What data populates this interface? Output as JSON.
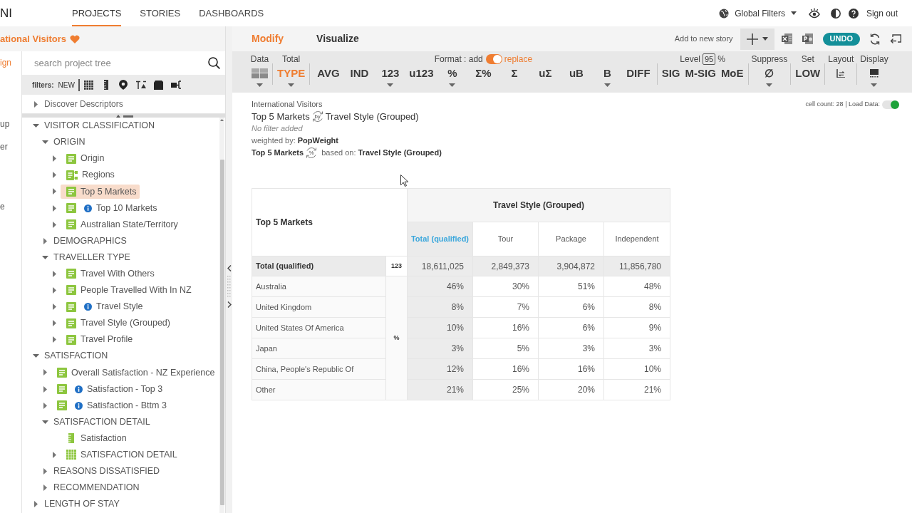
{
  "header": {
    "logo_text": "NI",
    "nav": [
      {
        "label": "PROJECTS",
        "selected": true
      },
      {
        "label": "STORIES",
        "selected": false
      },
      {
        "label": "DASHBOARDS",
        "selected": false
      }
    ],
    "global_filters": "Global Filters",
    "sign_out": "Sign out"
  },
  "project": {
    "title": "ational Visitors",
    "favorite": true
  },
  "left_menu": [
    {
      "label": "ign",
      "selected": true
    },
    {
      "label": "up",
      "selected": false
    },
    {
      "label": "er",
      "selected": false
    },
    {
      "label": "e",
      "selected": false
    }
  ],
  "sidebar": {
    "search": {
      "placeholder": "search project tree"
    },
    "filters_label": "filters:",
    "filters_new": "NEW",
    "descriptors": {
      "label": "Discover Descriptors",
      "expanded": false
    },
    "tree": [
      {
        "label": "VISITOR CLASSIFICATION",
        "kind": "folder",
        "expanded": true,
        "selected": false,
        "children": [
          {
            "label": "ORIGIN",
            "kind": "folder",
            "expanded": true,
            "selected": false,
            "children": [
              {
                "label": "Origin",
                "kind": "single",
                "expanded": false,
                "selected": false,
                "info": false
              },
              {
                "label": "Regions",
                "kind": "hierarchy",
                "expanded": false,
                "selected": false,
                "info": false
              },
              {
                "label": "Top 5 Markets",
                "kind": "single",
                "expanded": false,
                "selected": true,
                "info": false
              },
              {
                "label": "Top 10 Markets",
                "kind": "single",
                "expanded": false,
                "selected": false,
                "info": true
              },
              {
                "label": "Australian State/Territory",
                "kind": "single",
                "expanded": false,
                "selected": false,
                "info": false
              }
            ]
          },
          {
            "label": "DEMOGRAPHICS",
            "kind": "folder",
            "expanded": false,
            "selected": false
          },
          {
            "label": "TRAVELLER TYPE",
            "kind": "folder",
            "expanded": true,
            "selected": false,
            "children": [
              {
                "label": "Travel With Others",
                "kind": "single",
                "expanded": false,
                "selected": false,
                "info": false
              },
              {
                "label": "People Travelled With In NZ",
                "kind": "single",
                "expanded": false,
                "selected": false,
                "info": false
              },
              {
                "label": "Travel Style",
                "kind": "single",
                "expanded": false,
                "selected": false,
                "info": true
              },
              {
                "label": "Travel Style (Grouped)",
                "kind": "single",
                "expanded": false,
                "selected": false,
                "info": false
              },
              {
                "label": "Travel Profile",
                "kind": "single",
                "expanded": false,
                "selected": false,
                "info": false
              }
            ]
          }
        ]
      },
      {
        "label": "SATISFACTION",
        "kind": "folder",
        "expanded": true,
        "selected": false,
        "children": [
          {
            "label": "Overall Satisfaction - NZ Experience",
            "kind": "single",
            "expanded": false,
            "selected": false,
            "info": false
          },
          {
            "label": "Satisfaction - Top 3",
            "kind": "single",
            "expanded": false,
            "selected": false,
            "info": true
          },
          {
            "label": "Satisfaction - Bttm 3",
            "kind": "single",
            "expanded": false,
            "selected": false,
            "info": true
          },
          {
            "label": "SATISFACTION DETAIL",
            "kind": "folder",
            "expanded": true,
            "selected": false,
            "children": [
              {
                "label": "Satisfaction",
                "kind": "scale",
                "selected": false,
                "info": false
              },
              {
                "label": "SATISFACTION DETAIL",
                "kind": "grid",
                "expanded": false,
                "selected": false,
                "info": false
              }
            ]
          },
          {
            "label": "REASONS DISSATISFIED",
            "kind": "folder",
            "expanded": false,
            "selected": false
          },
          {
            "label": "RECOMMENDATION",
            "kind": "folder",
            "expanded": false,
            "selected": false
          }
        ]
      },
      {
        "label": "LENGTH OF STAY",
        "kind": "folder",
        "expanded": false,
        "selected": false
      }
    ]
  },
  "view_tabs": [
    {
      "label": "Modify",
      "selected": true
    },
    {
      "label": "Visualize",
      "selected": false
    }
  ],
  "actions": {
    "add_to_story": "Add to new story",
    "undo": "UNDO"
  },
  "toolbar": {
    "groups": [
      {
        "label": "Data",
        "buttons": [
          {
            "kind": "tiles",
            "selected": false,
            "dropdown": true
          }
        ]
      },
      {
        "label": "Total",
        "buttons": [
          {
            "kind": "text",
            "label": "TYPE",
            "selected": true,
            "dropdown": true
          }
        ]
      },
      {
        "format": {
          "label": "Format : add",
          "on": true,
          "alt_label": "replace"
        },
        "buttons": [
          {
            "kind": "text",
            "label": "AVG",
            "selected": false,
            "dropdown": false
          },
          {
            "kind": "text",
            "label": "IND",
            "selected": false,
            "dropdown": false
          },
          {
            "kind": "text",
            "label": "123",
            "selected": false,
            "dropdown": true
          },
          {
            "kind": "text",
            "label": "u123",
            "selected": false,
            "dropdown": false
          },
          {
            "kind": "text",
            "label": "%",
            "selected": false,
            "dropdown": true
          },
          {
            "kind": "text",
            "label": "Σ%",
            "selected": false,
            "dropdown": false
          },
          {
            "kind": "text",
            "label": "Σ",
            "selected": false,
            "dropdown": false
          },
          {
            "kind": "text",
            "label": "uΣ",
            "selected": false,
            "dropdown": false
          },
          {
            "kind": "text",
            "label": "uB",
            "selected": false,
            "dropdown": false
          },
          {
            "kind": "text",
            "label": "B",
            "selected": false,
            "dropdown": true
          },
          {
            "kind": "text",
            "label": "DIFF",
            "selected": false,
            "dropdown": false
          }
        ]
      },
      {
        "level": {
          "label": "Level",
          "value": "95",
          "unit": "%"
        },
        "buttons": [
          {
            "kind": "text",
            "label": "SIG",
            "selected": false,
            "dropdown": false
          },
          {
            "kind": "text",
            "label": "M-SIG",
            "selected": false,
            "dropdown": false
          },
          {
            "kind": "text",
            "label": "MoE",
            "selected": false,
            "dropdown": false
          }
        ]
      },
      {
        "label": "Suppress",
        "buttons": [
          {
            "kind": "text",
            "label": "∅",
            "selected": false,
            "dropdown": true
          }
        ]
      },
      {
        "label": "Set",
        "buttons": [
          {
            "kind": "text",
            "label": "LOW",
            "selected": false,
            "dropdown": false
          }
        ]
      },
      {
        "label": "Layout",
        "buttons": [
          {
            "kind": "layout",
            "selected": false,
            "dropdown": false
          }
        ]
      },
      {
        "label": "Display",
        "buttons": [
          {
            "kind": "display",
            "selected": false,
            "dropdown": true
          }
        ]
      }
    ]
  },
  "summary": {
    "project": "International Visitors",
    "title": {
      "row": "Top 5 Markets",
      "connector": "by",
      "column": "Travel Style (Grouped)"
    },
    "filter": "No filter added",
    "weight": {
      "label": "weighted by:",
      "value": "PopWeight"
    },
    "base": {
      "variable": "Top 5 Markets",
      "symbol": "%",
      "label": "based on:",
      "value": "Travel Style (Grouped)"
    },
    "cell_count": "cell count: 28 | Load Data:",
    "load_data_on": true
  },
  "table": {
    "corner": "Top 5 Markets",
    "column_group": "Travel Style (Grouped)",
    "columns": [
      {
        "label": "Total (qualified)",
        "kind": "total"
      },
      {
        "label": "Tour",
        "kind": "category"
      },
      {
        "label": "Package",
        "kind": "category"
      },
      {
        "label": "Independent",
        "kind": "category"
      }
    ],
    "rows": [
      {
        "label": "Total (qualified)",
        "kind": "total",
        "stat": "123",
        "values": [
          "18,611,025",
          "2,849,373",
          "3,904,872",
          "11,856,780"
        ]
      },
      {
        "label": "Australia",
        "kind": "category",
        "stat": "%",
        "values": [
          "46%",
          "30%",
          "51%",
          "48%"
        ]
      },
      {
        "label": "United Kingdom",
        "kind": "category",
        "values": [
          "8%",
          "7%",
          "6%",
          "8%"
        ]
      },
      {
        "label": "United States Of America",
        "kind": "category",
        "values": [
          "10%",
          "16%",
          "6%",
          "9%"
        ]
      },
      {
        "label": "Japan",
        "kind": "category",
        "values": [
          "3%",
          "5%",
          "3%",
          "3%"
        ]
      },
      {
        "label": "China, People's Republic Of",
        "kind": "category",
        "values": [
          "12%",
          "16%",
          "16%",
          "10%"
        ]
      },
      {
        "label": "Other",
        "kind": "category",
        "values": [
          "21%",
          "25%",
          "20%",
          "21%"
        ]
      }
    ]
  }
}
